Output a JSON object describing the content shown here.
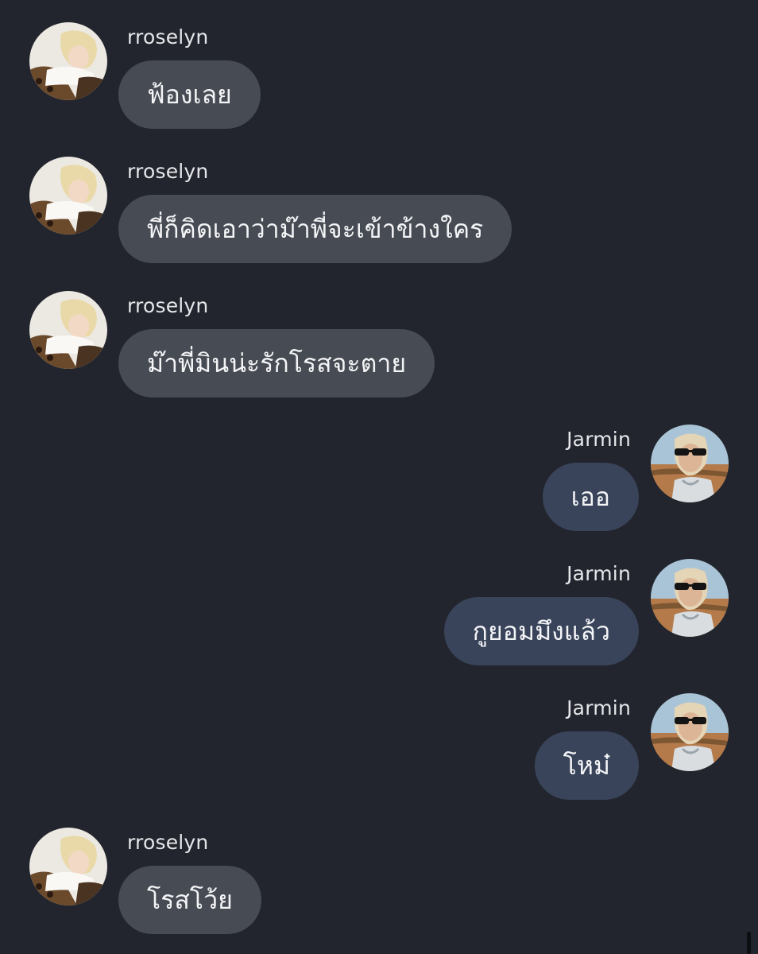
{
  "messages": [
    {
      "sender": "rroselyn",
      "side": "left",
      "text": "ฟ้องเลย"
    },
    {
      "sender": "rroselyn",
      "side": "left",
      "text": "พี่ก็คิดเอาว่าม๊าพี่จะเข้าข้างใคร"
    },
    {
      "sender": "rroselyn",
      "side": "left",
      "text": "ม๊าพี่มินน่ะรักโรสจะตาย"
    },
    {
      "sender": "Jarmin",
      "side": "right",
      "text": "เออ"
    },
    {
      "sender": "Jarmin",
      "side": "right",
      "text": "กูยอมมึงแล้ว"
    },
    {
      "sender": "Jarmin",
      "side": "right",
      "text": "โหม๋"
    },
    {
      "sender": "rroselyn",
      "side": "left",
      "text": "โรสโว้ย"
    }
  ],
  "colors": {
    "background": "#22252d",
    "incoming_bubble": "#474b53",
    "outgoing_bubble": "#39445a",
    "text": "#f3f4f6"
  }
}
